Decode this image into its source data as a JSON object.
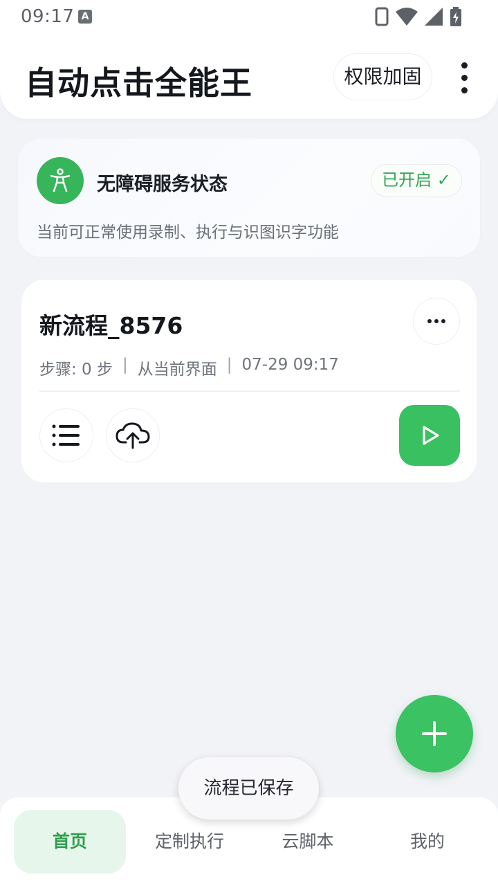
{
  "status_bar": {
    "time": "09:17",
    "icons": [
      "a-notification-icon",
      "phone-icon",
      "wifi-icon",
      "signal-icon",
      "battery-charging-icon"
    ]
  },
  "header": {
    "title": "自动点击全能王",
    "permission_button": "权限加固",
    "more_icon": "vertical-dots-icon"
  },
  "accessibility": {
    "title": "无障碍服务状态",
    "badge": "已开启 ✓",
    "description": "当前可正常使用录制、执行与识图识字功能",
    "icon": "accessibility-person-icon"
  },
  "flow_card": {
    "name": "新流程_8576",
    "steps": "步骤: 0 步",
    "origin": "从当前界面",
    "time": "07-29 09:17",
    "separator": "|",
    "actions": [
      "list-icon",
      "cloud-upload-icon",
      "play-icon"
    ]
  },
  "fab": {
    "icon": "plus-icon"
  },
  "toast": {
    "text": "流程已保存"
  },
  "bottom_nav": {
    "items": [
      {
        "label": "首页",
        "active": true
      },
      {
        "label": "定制执行",
        "active": false
      },
      {
        "label": "云脚本",
        "active": false
      },
      {
        "label": "我的",
        "active": false
      }
    ]
  },
  "colors": {
    "accent": "#39c060",
    "background": "#f1f3f7",
    "badge_text": "#2fa752",
    "nav_active_bg": "#e7f6ea"
  }
}
